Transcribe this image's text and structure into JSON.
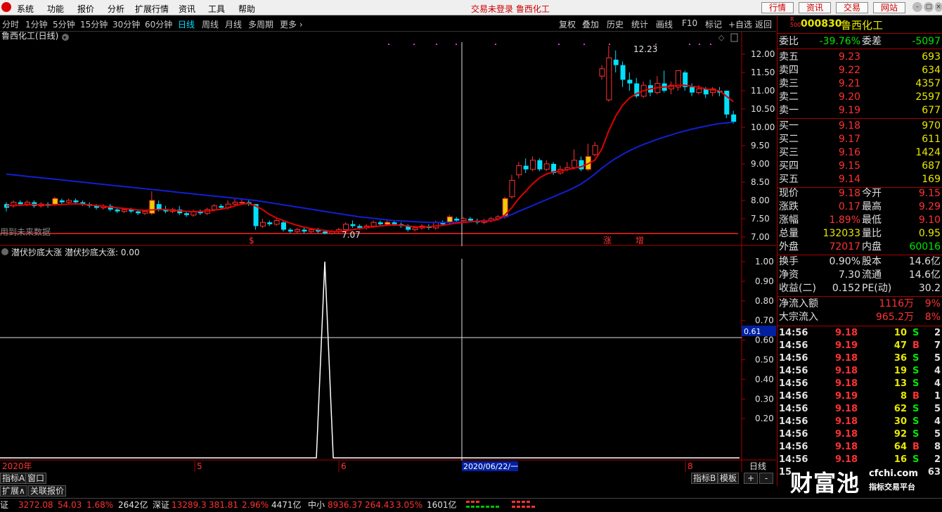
{
  "menubar": {
    "items": [
      "系统",
      "功能",
      "报价",
      "分析",
      "扩展行情",
      "资讯",
      "工具",
      "帮助"
    ],
    "status": "交易未登录 鲁西化工",
    "buttons": [
      "行情",
      "资讯",
      "交易",
      "网站"
    ]
  },
  "periods": [
    "分时",
    "1分钟",
    "5分钟",
    "15分钟",
    "30分钟",
    "60分钟",
    "日线",
    "周线",
    "月线",
    "多周期",
    "更多"
  ],
  "active_period": "日线",
  "tools": [
    "复权",
    "叠加",
    "历史",
    "统计",
    "画线",
    "F10",
    "标记",
    "+自选",
    "返回"
  ],
  "chart": {
    "title": "鲁西化工(日线)",
    "price_ticks": [
      "12.00",
      "11.50",
      "11.00",
      "10.50",
      "10.00",
      "9.50",
      "9.00",
      "8.50",
      "8.00",
      "7.50",
      "7.00"
    ],
    "high_label": "12.23",
    "low_label": "7.07",
    "note": "用到未来数据",
    "markers": [
      "$",
      "涨",
      "增"
    ]
  },
  "indicator": {
    "title": "潜伏抄底大涨",
    "value_text": "潜伏抄底大涨: 0.00",
    "ticks": [
      "1.00",
      "0.90",
      "0.80",
      "0.70",
      "0.60",
      "0.50",
      "0.40",
      "0.30",
      "0.20"
    ],
    "cursor_value": "0.61"
  },
  "time_axis": {
    "labels": [
      "2020年",
      "5",
      "6",
      "8"
    ],
    "cursor_date": "2020/06/22/一",
    "period_label": "日线"
  },
  "quote": {
    "code": "000830",
    "name": "鲁西化工",
    "badge_r": "R",
    "badge_num": "500",
    "weibi_label": "委比",
    "weibi": "-39.76%",
    "weicha_label": "委差",
    "weicha": "-5097",
    "asks": [
      {
        "label": "卖五",
        "price": "9.23",
        "vol": "693"
      },
      {
        "label": "卖四",
        "price": "9.22",
        "vol": "634"
      },
      {
        "label": "卖三",
        "price": "9.21",
        "vol": "4357"
      },
      {
        "label": "卖二",
        "price": "9.20",
        "vol": "2597"
      },
      {
        "label": "卖一",
        "price": "9.19",
        "vol": "677"
      }
    ],
    "bids": [
      {
        "label": "买一",
        "price": "9.18",
        "vol": "970"
      },
      {
        "label": "买二",
        "price": "9.17",
        "vol": "611"
      },
      {
        "label": "买三",
        "price": "9.16",
        "vol": "1424"
      },
      {
        "label": "买四",
        "price": "9.15",
        "vol": "687"
      },
      {
        "label": "买五",
        "price": "9.14",
        "vol": "169"
      }
    ],
    "stats": [
      {
        "l1": "现价",
        "v1": "9.18",
        "c1": "red",
        "l2": "今开",
        "v2": "9.15",
        "c2": "red"
      },
      {
        "l1": "涨跌",
        "v1": "0.17",
        "c1": "red",
        "l2": "最高",
        "v2": "9.29",
        "c2": "red"
      },
      {
        "l1": "涨幅",
        "v1": "1.89%",
        "c1": "red",
        "l2": "最低",
        "v2": "9.10",
        "c2": "red"
      },
      {
        "l1": "总量",
        "v1": "132033",
        "c1": "yellow",
        "l2": "量比",
        "v2": "0.95",
        "c2": "yellow"
      },
      {
        "l1": "外盘",
        "v1": "72017",
        "c1": "red",
        "l2": "内盘",
        "v2": "60016",
        "c2": "green"
      }
    ],
    "fin": [
      {
        "l1": "换手",
        "v1": "0.90%",
        "l2": "股本",
        "v2": "14.6亿"
      },
      {
        "l1": "净资",
        "v1": "7.30",
        "l2": "流通",
        "v2": "14.6亿"
      },
      {
        "l1": "收益(二)",
        "v1": "0.152",
        "l2": "PE(动)",
        "v2": "30.2"
      }
    ],
    "flow": [
      {
        "label": "净流入额",
        "value": "1116万",
        "pct": "9%"
      },
      {
        "label": "大宗流入",
        "value": "965.2万",
        "pct": "8%"
      }
    ],
    "ticks": [
      {
        "t": "14:56",
        "p": "9.18",
        "v": "10",
        "s": "S",
        "n": "2"
      },
      {
        "t": "14:56",
        "p": "9.19",
        "v": "47",
        "s": "B",
        "n": "7"
      },
      {
        "t": "14:56",
        "p": "9.18",
        "v": "36",
        "s": "S",
        "n": "5"
      },
      {
        "t": "14:56",
        "p": "9.18",
        "v": "19",
        "s": "S",
        "n": "4"
      },
      {
        "t": "14:56",
        "p": "9.18",
        "v": "13",
        "s": "S",
        "n": "4"
      },
      {
        "t": "14:56",
        "p": "9.19",
        "v": "8",
        "s": "B",
        "n": "1"
      },
      {
        "t": "14:56",
        "p": "9.18",
        "v": "62",
        "s": "S",
        "n": "5"
      },
      {
        "t": "14:56",
        "p": "9.18",
        "v": "30",
        "s": "S",
        "n": "4"
      },
      {
        "t": "14:56",
        "p": "9.18",
        "v": "92",
        "s": "S",
        "n": "5"
      },
      {
        "t": "14:56",
        "p": "9.18",
        "v": "64",
        "s": "B",
        "n": "8"
      },
      {
        "t": "14:56",
        "p": "9.18",
        "v": "16",
        "s": "S",
        "n": "2"
      },
      {
        "t": "15",
        "p": "",
        "v": "",
        "s": "",
        "n": "63"
      }
    ],
    "tabs": [
      "笔",
      "价",
      "细",
      "势",
      "联",
      "值",
      "主",
      "筹"
    ]
  },
  "bottom_tabs": {
    "row1": [
      "指标A",
      "窗口"
    ],
    "row1_right": [
      "指标B",
      "模板",
      "+",
      "-"
    ],
    "row2": [
      "扩展∧",
      "关联报价"
    ]
  },
  "statusbar": [
    {
      "name": "证",
      "val": "3272.08",
      "chg": "54.03",
      "pct": "1.68%",
      "amt": "2642亿"
    },
    {
      "name": "深证",
      "val": "13289.3",
      "chg": "381.81",
      "pct": "2.96%",
      "amt": "4471亿"
    },
    {
      "name": "中小",
      "val": "8936.37",
      "chg": "264.43",
      "pct": "3.05%",
      "amt": "1601亿"
    }
  ],
  "watermark": {
    "brand": "财富池",
    "site": "cfchi.com",
    "tag": "指标交易平台"
  },
  "colors": {
    "up": "#ff3232",
    "down": "#00e0ff",
    "ma_short": "#e00000",
    "ma_long": "#1020d0",
    "bg": "#000000"
  }
}
